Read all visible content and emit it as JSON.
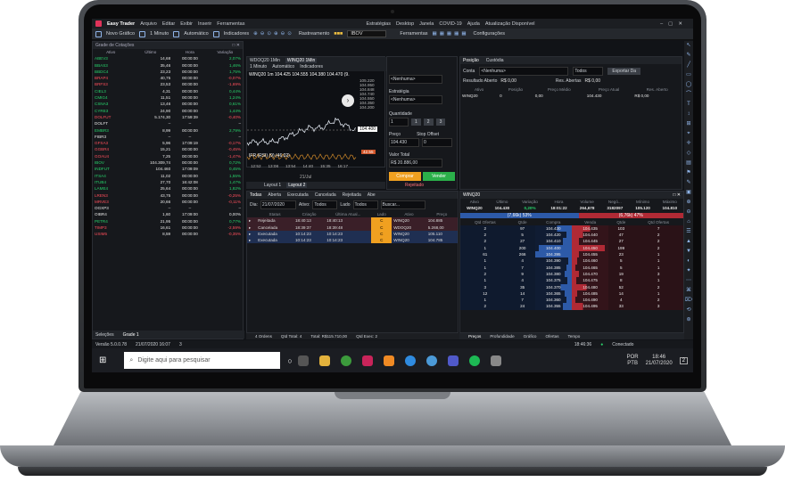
{
  "app": {
    "brand": "Easy Trader",
    "menus": [
      "Arquivo",
      "Editar",
      "Exibir",
      "Inserir",
      "Ferramentas"
    ],
    "center_menus": [
      "Estratégias",
      "Desktop",
      "Janela",
      "COVID-19",
      "Ajuda",
      "Atualização Disponível"
    ]
  },
  "toolbar": {
    "new_chart": "Novo Gráfico",
    "interval": "1 Minuto",
    "auto": "Automático",
    "indicators": "Indicadores",
    "tracking": "Rastreamento",
    "symbol": "IBOV",
    "tools": "Ferramentas",
    "settings": "Configurações"
  },
  "quotes": {
    "title": "Grade de Cotações",
    "headers": [
      "Ativo",
      "Último",
      "Hora",
      "Variação"
    ],
    "rows": [
      [
        "ABEV3",
        "14,68",
        "00:00:00",
        "2,07%",
        "g"
      ],
      [
        "BBAS3",
        "35,46",
        "00:00:00",
        "1,46%",
        "g"
      ],
      [
        "BBDC4",
        "23,23",
        "00:00:00",
        "1,75%",
        "g"
      ],
      [
        "BRAP4",
        "40,75",
        "00:00:00",
        "-0,07%",
        "r"
      ],
      [
        "BRFS3",
        "23,53",
        "00:00:00",
        "-1,69%",
        "r"
      ],
      [
        "CIEL3",
        "4,31",
        "00:00:00",
        "0,44%",
        "g"
      ],
      [
        "CMIG4",
        "11,51",
        "00:00:00",
        "1,24%",
        "g"
      ],
      [
        "CSNA3",
        "13,46",
        "00:00:00",
        "0,61%",
        "g"
      ],
      [
        "CYRE3",
        "24,90",
        "00:00:00",
        "1,44%",
        "g"
      ],
      [
        "DOLFUT",
        "5.174,30",
        "17:59:39",
        "-0,40%",
        "r"
      ],
      [
        "DOLFT",
        "–",
        "–",
        "–",
        "w"
      ],
      [
        "EMBR3",
        "8,99",
        "00:00:00",
        "2,79%",
        "g"
      ],
      [
        "FIBR3",
        "–",
        "–",
        "–",
        "w"
      ],
      [
        "GFSA3",
        "5,96",
        "17:09:19",
        "-0,17%",
        "r"
      ],
      [
        "GGBR4",
        "15,21",
        "00:00:00",
        "-0,45%",
        "r"
      ],
      [
        "GOAU4",
        "7,25",
        "00:00:00",
        "-1,47%",
        "r"
      ],
      [
        "IBOV",
        "104.309,74",
        "00:00:00",
        "0,72%",
        "g"
      ],
      [
        "INDFUT",
        "104.460",
        "17:09:09",
        "0,45%",
        "g"
      ],
      [
        "ITSA4",
        "11,02",
        "00:00:00",
        "1,55%",
        "g"
      ],
      [
        "ITUB4",
        "27,70",
        "16:42:08",
        "1,47%",
        "g"
      ],
      [
        "LAME4",
        "25,64",
        "00:00:00",
        "1,82%",
        "g"
      ],
      [
        "LREN3",
        "43,75",
        "00:00:00",
        "-0,25%",
        "r"
      ],
      [
        "MRVE3",
        "20,66",
        "00:00:00",
        "-0,11%",
        "r"
      ],
      [
        "OGXP3",
        "–",
        "–",
        "–",
        "w"
      ],
      [
        "OIBR4",
        "1,60",
        "17:09:00",
        "0,00%",
        "w"
      ],
      [
        "PETR4",
        "21,95",
        "00:00:00",
        "0,77%",
        "g"
      ],
      [
        "TIMP3",
        "16,61",
        "00:00:00",
        "-2,59%",
        "r"
      ],
      [
        "USIM5",
        "8,59",
        "00:00:00",
        "-0,35%",
        "r"
      ]
    ],
    "tab_first": "Seleções",
    "tab_grid": "Grade 1"
  },
  "chart": {
    "tabs": [
      "WDOQ20 1Min",
      "WINQ20 1Min"
    ],
    "interval": "1 Minuto",
    "auto": "Automático",
    "indicators": "Indicadores",
    "caption": "WINQ20 1m 104.425 104.555 104.380 104.470 (9.",
    "last_price": "104.400",
    "axis": [
      "105.220",
      "104.950",
      "104.848",
      "104.740",
      "104.550",
      "104.350",
      "104.200"
    ],
    "time_ticks": [
      "12:52",
      "13:08",
      "13:54",
      "14:40",
      "15:35",
      "16:17"
    ],
    "ifr_label": "IFR (RSI) (9) (46,02)",
    "ifr_value": "42.55",
    "date_label": "21/Jul",
    "layout_tabs": [
      "Layout 1",
      "Layout 2"
    ]
  },
  "order": {
    "strategy_label": "Estratégia",
    "strategy": "<Nenhuma>",
    "account": "<Nenhuma>",
    "qty_label": "Quantidade",
    "qty": "1",
    "qty_presets": [
      "1",
      "2",
      "3"
    ],
    "price_label": "Preço",
    "price": "104.430",
    "stop_label": "Stop Offset",
    "stop": "0",
    "total_label": "Valor Total",
    "total": "R$ 20.886,00",
    "buy": "Comprar",
    "sell": "Vender",
    "status": "Rejeitado"
  },
  "position": {
    "tabs": [
      "Posição",
      "Custódia"
    ],
    "account_label": "Conta",
    "account": "<Nenhuma>",
    "filter": "Todos",
    "export": "Exportar Da",
    "open_label": "Resultado Aberto",
    "open_value": "R$ 0,00",
    "closed_label": "Res. Abertas",
    "closed_value": "R$ 0,00",
    "headers": [
      "Ativo",
      "Posição",
      "Preço Médio",
      "Preço Atual",
      "Res. Aberto"
    ],
    "row": [
      "WINQ20",
      "0",
      "0,00",
      "104.430",
      "R$ 0,00"
    ]
  },
  "orders": {
    "tabs": [
      "Todas",
      "Aberta",
      "Executada",
      "Cancelada",
      "Rejeitada",
      "Abe"
    ],
    "date_label": "Dia:",
    "date": "21/07/2020",
    "asset_label": "Ativo:",
    "asset": "Todos",
    "side_label": "Lado",
    "side": "Todos",
    "search": "Buscar...",
    "headers": [
      "Status",
      "Criação",
      "Última Atual...",
      "Lado",
      "Ativo",
      "Preço"
    ],
    "rows": [
      [
        "Rejeitada",
        "18:40:13",
        "18:40:13",
        "C",
        "WINQ20",
        "104.885",
        "r"
      ],
      [
        "Cancelada",
        "18:39:37",
        "18:39:48",
        "C",
        "WDOQ20",
        "5.268,00",
        "r"
      ],
      [
        "Executada",
        "10:14:23",
        "10:14:23",
        "C",
        "WINQ20",
        "105.110",
        "b"
      ],
      [
        "Executada",
        "10:14:23",
        "10:14:23",
        "C",
        "WINQ20",
        "104.785",
        "b"
      ]
    ],
    "footer": [
      "4 Ordens",
      "Qtd Total: 4",
      "Total: R$115.710,00",
      "Qtd Exec: 2",
      "Qtd Exec: 2"
    ]
  },
  "book": {
    "title": "WINQ20",
    "headers": [
      "Ativo",
      "Último",
      "Variação",
      "Hora",
      "Volume",
      "Negó...",
      "Mínimo",
      "Máximo"
    ],
    "summary": [
      "WINQ20",
      "104.430",
      "0,20%",
      "18:01:22",
      "264,678",
      "3182097",
      "105.120",
      "104.810"
    ],
    "buy_pct": "(7,66k) 53%",
    "sell_pct": "(6,76k) 47%",
    "cols": [
      "Qtd Ofertas",
      "Qtde",
      "Compra",
      "Venda",
      "Qtde",
      "Qtd Ofertas"
    ],
    "rows": [
      [
        "2",
        "97",
        "104.430",
        "104.435",
        "103",
        "7",
        0.4,
        0.5
      ],
      [
        "2",
        "5",
        "104.420",
        "104.440",
        "47",
        "2",
        0.15,
        0.3
      ],
      [
        "2",
        "27",
        "104.410",
        "104.445",
        "27",
        "2",
        0.25,
        0.2
      ],
      [
        "1",
        "200",
        "104.400",
        "104.450",
        "199",
        "2",
        0.9,
        0.9
      ],
      [
        "61",
        "266",
        "104.395",
        "104.455",
        "23",
        "1",
        1,
        0.2
      ],
      [
        "1",
        "4",
        "104.390",
        "104.460",
        "5",
        "1",
        0.1,
        0.15
      ],
      [
        "1",
        "7",
        "104.385",
        "104.465",
        "5",
        "1",
        0.15,
        0.1
      ],
      [
        "2",
        "9",
        "104.380",
        "104.470",
        "19",
        "3",
        0.2,
        0.2
      ],
      [
        "1",
        "4",
        "104.375",
        "104.475",
        "8",
        "1",
        0.12,
        0.12
      ],
      [
        "3",
        "35",
        "104.370",
        "104.480",
        "52",
        "2",
        0.3,
        0.4
      ],
      [
        "12",
        "14",
        "104.365",
        "104.485",
        "14",
        "1",
        0.2,
        0.15
      ],
      [
        "1",
        "7",
        "104.360",
        "104.490",
        "4",
        "2",
        0.15,
        0.1
      ],
      [
        "2",
        "24",
        "104.355",
        "104.495",
        "33",
        "3",
        0.25,
        0.3
      ]
    ],
    "tabs": [
      "Preços",
      "Profundidade",
      "Gráfico",
      "Ofertas",
      "Tempo"
    ]
  },
  "status": {
    "version": "Versão 5.0.0.78",
    "datetime": "21/07/2020 16:07",
    "count": "3",
    "time": "18:46:36",
    "connected": "Conectado"
  },
  "taskbar": {
    "search": "Digite aqui para pesquisar",
    "lang": "POR",
    "layout": "PTB",
    "clock": "18:46",
    "date": "21/07/2020",
    "notif": "2"
  }
}
